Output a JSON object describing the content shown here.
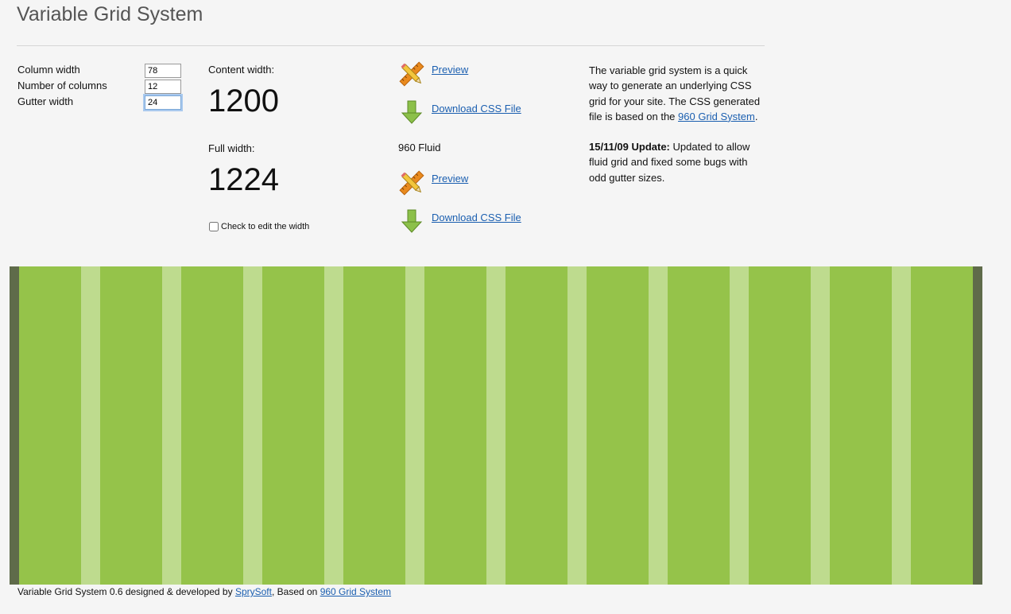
{
  "page": {
    "title": "Variable Grid System"
  },
  "form": {
    "column_width_label": "Column width",
    "column_width_value": "78",
    "num_columns_label": "Number of columns",
    "num_columns_value": "12",
    "gutter_width_label": "Gutter width",
    "gutter_width_value": "24"
  },
  "stats": {
    "content_width_label": "Content width:",
    "content_width_value": "1200",
    "full_width_label": "Full width:",
    "full_width_value": "1224",
    "edit_width_label": "Check to edit the width"
  },
  "actions": {
    "preview_label": "Preview",
    "download_label": "Download CSS File",
    "fluid_label": "960 Fluid",
    "fluid_preview_label": "Preview",
    "fluid_download_label": "Download CSS File"
  },
  "description": {
    "intro_before_link": "The variable grid system is a quick way to generate an underlying CSS grid for your site. The CSS generated file is based on the ",
    "intro_link": "960 Grid System",
    "intro_after_link": ".",
    "update_bold": "15/11/09 Update:",
    "update_text": " Updated to allow fluid grid and fixed some bugs with odd gutter sizes."
  },
  "grid": {
    "columns": 12,
    "column_color": "#95c34a",
    "gutter_color": "#bedb8e",
    "frame_color": "#5f6b4a"
  },
  "footer": {
    "text_before": "Variable Grid System 0.6 designed & developed by ",
    "link_spry": "SprySoft",
    "text_middle": ", Based on ",
    "link_960": "960 Grid System"
  },
  "icons": {
    "preview": "pencil-ruler-icon",
    "download": "download-arrow-icon"
  }
}
